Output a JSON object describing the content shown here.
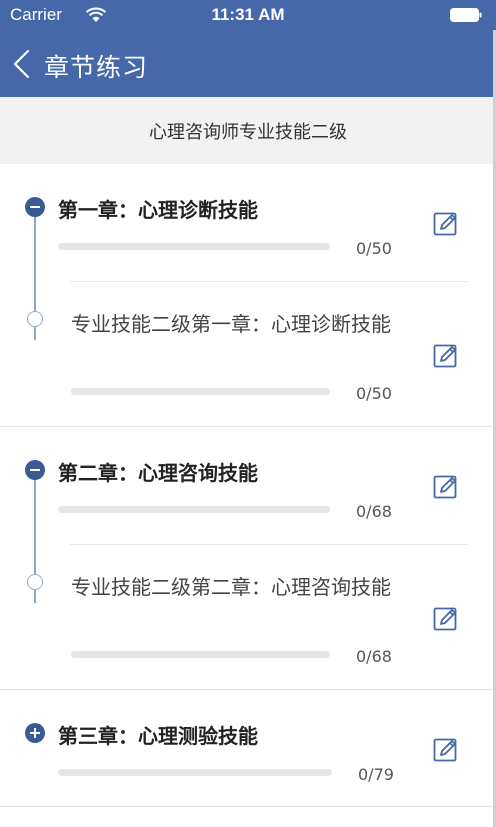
{
  "status_bar": {
    "carrier": "Carrier",
    "time": "11:31 AM"
  },
  "nav": {
    "title": "章节练习"
  },
  "subject": {
    "title": "心理咨询师专业技能二级"
  },
  "colors": {
    "accent": "#4468a8",
    "dot": "#3a5a94"
  },
  "chapters": [
    {
      "title": "第一章：心理诊断技能",
      "count": "0/50",
      "progress": 0,
      "expanded": true,
      "sub": {
        "title": "专业技能二级第一章：心理诊断技能",
        "count": "0/50",
        "progress": 0
      }
    },
    {
      "title": "第二章：心理咨询技能",
      "count": "0/68",
      "progress": 0,
      "expanded": true,
      "sub": {
        "title": "专业技能二级第二章：心理咨询技能",
        "count": "0/68",
        "progress": 0
      }
    },
    {
      "title": "第三章：心理测验技能",
      "count": "0/79",
      "progress": 0,
      "expanded": false
    }
  ]
}
